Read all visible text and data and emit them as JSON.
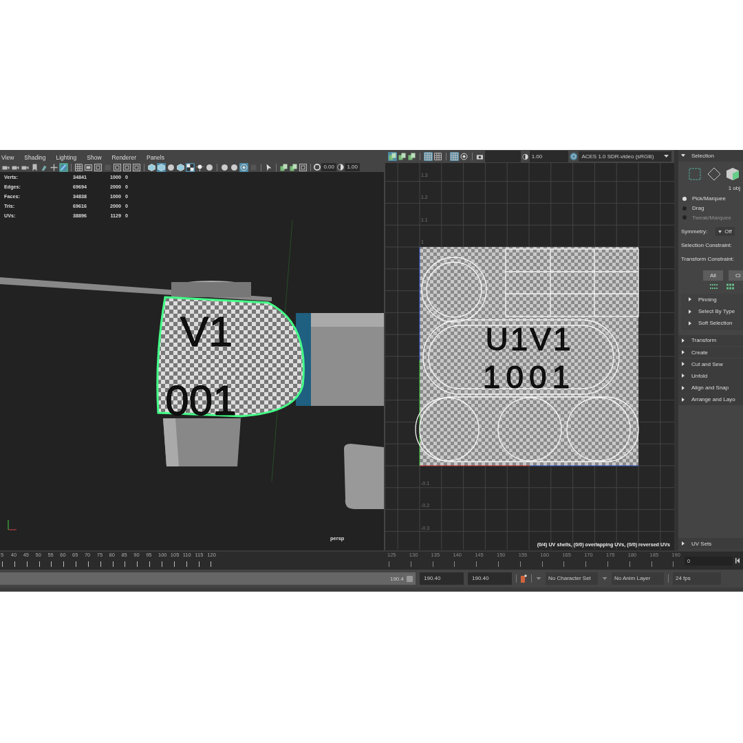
{
  "viewport": {
    "menu": [
      "View",
      "Shading",
      "Lighting",
      "Show",
      "Renderer",
      "Panels"
    ],
    "toolbar_groups": [
      [
        {
          "kind": "camera",
          "selected": false
        },
        {
          "kind": "camera",
          "selected": false
        },
        {
          "kind": "camera",
          "selected": false
        },
        {
          "kind": "bookmark",
          "selected": false
        },
        {
          "kind": "brush",
          "selected": false
        },
        {
          "kind": "move",
          "selected": false
        },
        {
          "kind": "pencil",
          "selected": true
        }
      ],
      [
        {
          "kind": "grid",
          "selected": false
        },
        {
          "kind": "film",
          "selected": false
        },
        {
          "kind": "gate",
          "selected": false
        },
        {
          "kind": "square",
          "selected": false
        },
        {
          "kind": "gate",
          "selected": false
        },
        {
          "kind": "gate",
          "selected": false
        },
        {
          "kind": "gate",
          "selected": false
        }
      ],
      [
        {
          "kind": "cube",
          "selected": false
        },
        {
          "kind": "cube",
          "selected": true
        },
        {
          "kind": "sphere",
          "selected": false
        },
        {
          "kind": "cube",
          "selected": false
        },
        {
          "kind": "checker",
          "selected": true
        },
        {
          "kind": "light",
          "selected": false
        },
        {
          "kind": "sphere",
          "selected": false
        }
      ],
      [
        {
          "kind": "sphere",
          "selected": false
        },
        {
          "kind": "sphere",
          "selected": false
        },
        {
          "kind": "target",
          "selected": true
        },
        {
          "kind": "square",
          "selected": false
        }
      ],
      [
        {
          "kind": "cursor",
          "selected": false
        }
      ],
      [
        {
          "kind": "layers",
          "selected": false
        },
        {
          "kind": "layers",
          "selected": false
        },
        {
          "kind": "gate",
          "selected": false
        }
      ]
    ],
    "exposure": "0.00",
    "gamma": "1.00",
    "stats": [
      {
        "label": "Verts:",
        "values": [
          "34841",
          "1000",
          "0"
        ]
      },
      {
        "label": "Edges:",
        "values": [
          "69694",
          "2000",
          "0"
        ]
      },
      {
        "label": "Faces:",
        "values": [
          "34838",
          "1000",
          "0"
        ]
      },
      {
        "label": "Tris:",
        "values": [
          "69616",
          "2000",
          "0"
        ]
      },
      {
        "label": "UVs:",
        "values": [
          "38896",
          "1129",
          "0"
        ]
      }
    ],
    "texture_text": [
      "V1",
      "001"
    ],
    "camera_label": "persp"
  },
  "uv_editor": {
    "toolbar_groups": [
      [
        {
          "kind": "layers",
          "selected": true
        },
        {
          "kind": "layers",
          "selected": false
        },
        {
          "kind": "layers",
          "selected": false
        }
      ],
      [
        {
          "kind": "grid",
          "selected": true
        },
        {
          "kind": "grid",
          "selected": false
        }
      ],
      [
        {
          "kind": "grid",
          "selected": true
        },
        {
          "kind": "target",
          "selected": false
        }
      ]
    ],
    "gamma": "1.00",
    "color_space": "ACES 1.0 SDR-video (sRGB)",
    "axis_labels": [
      "1.3",
      "1.2",
      "1.1",
      "1",
      "-0.1",
      "-0.2",
      "-0.3"
    ],
    "texture_text": [
      "U1V1",
      "1001"
    ],
    "status": "(0/4) UV shells, (0/0) overlapping UVs, (0/0) reversed UVs"
  },
  "side_panel": {
    "selection": {
      "title": "Selection",
      "expanded": true,
      "object_count": "1 obj",
      "modes": [
        {
          "label": "Pick/Marquee",
          "selected": true,
          "disabled": false
        },
        {
          "label": "Drag",
          "selected": false,
          "disabled": false
        },
        {
          "label": "Tweak/Marquee",
          "selected": false,
          "disabled": true
        }
      ],
      "symmetry_label": "Symmetry:",
      "symmetry_value": "Off",
      "constraints": [
        "Selection Constraint:",
        "Transform Constraint:"
      ],
      "buttons": [
        "All",
        "Cl"
      ],
      "subsections": [
        {
          "title": "Pinning",
          "expanded": false
        },
        {
          "title": "Select By Type",
          "expanded": false
        },
        {
          "title": "Soft Selection",
          "expanded": false
        }
      ]
    },
    "sections": [
      {
        "title": "Transform",
        "expanded": false
      },
      {
        "title": "Create",
        "expanded": false
      },
      {
        "title": "Cut and Sew",
        "expanded": false
      },
      {
        "title": "Unfold",
        "expanded": false
      },
      {
        "title": "Align and Snap",
        "expanded": false
      },
      {
        "title": "Arrange and Layo",
        "expanded": false
      }
    ],
    "uv_sets": {
      "title": "UV Sets",
      "expanded": false
    }
  },
  "timeline": {
    "left_ticks": [
      "5",
      "40",
      "45",
      "50",
      "55",
      "60",
      "65",
      "70",
      "75",
      "80",
      "85",
      "90",
      "95",
      "100",
      "105",
      "110",
      "115",
      "120"
    ],
    "right_ticks": {
      "dimmed": true,
      "labels": [
        "125",
        "130",
        "135",
        "140",
        "145",
        "150",
        "155",
        "160",
        "165",
        "170",
        "175",
        "180",
        "185",
        "190"
      ]
    },
    "current_frame": "0"
  },
  "range_bar": {
    "level": 1,
    "range_end": "190.4",
    "fields": [
      "190.40",
      "190.40"
    ],
    "character_set": "No Character Set",
    "anim_layer": "No Anim Layer",
    "fps": "24 fps"
  }
}
